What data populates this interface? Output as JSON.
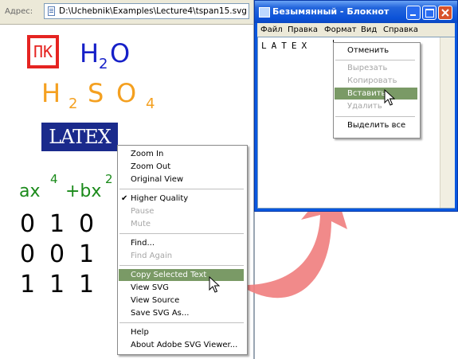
{
  "browser": {
    "address_label": "Адрес:",
    "address_value": "D:\\Uchebnik\\Examples\\Lecture4\\tspan15.svg"
  },
  "svg_content": {
    "pk_logo": "ПК",
    "h2o": {
      "base1": "H",
      "sub": "2",
      "base2": "O"
    },
    "h2so4": {
      "h": "H",
      "sub1": "2",
      "s": "S",
      "o": "O",
      "sub2": "4"
    },
    "latex_logo": "LATEX",
    "formula": {
      "a": "ax",
      "exp1": "4",
      "b": "+bx",
      "exp2": "2"
    },
    "matrix": [
      [
        "0",
        "1",
        "0"
      ],
      [
        "0",
        "0",
        "1"
      ],
      [
        "1",
        "1",
        "1"
      ]
    ]
  },
  "context_menu": {
    "items": [
      {
        "label": "Zoom In",
        "enabled": true
      },
      {
        "label": "Zoom Out",
        "enabled": true
      },
      {
        "label": "Original View",
        "enabled": true
      },
      {
        "label": "Higher Quality",
        "enabled": true,
        "checked": true
      },
      {
        "label": "Pause",
        "enabled": false
      },
      {
        "label": "Mute",
        "enabled": false
      },
      {
        "label": "Find...",
        "enabled": true
      },
      {
        "label": "Find Again",
        "enabled": false
      },
      {
        "label": "Copy Selected Text",
        "enabled": true,
        "highlighted": true
      },
      {
        "label": "View SVG",
        "enabled": true
      },
      {
        "label": "View Source",
        "enabled": true
      },
      {
        "label": "Save SVG As...",
        "enabled": true
      },
      {
        "label": "Help",
        "enabled": true
      },
      {
        "label": "About Adobe SVG Viewer...",
        "enabled": true
      }
    ],
    "check_glyph": "✔"
  },
  "notepad": {
    "title": "Безымянный - Блокнот",
    "menu": [
      "Файл",
      "Правка",
      "Формат",
      "Вид",
      "Справка"
    ],
    "text": "LATEX",
    "context_menu": {
      "items": [
        {
          "label": "Отменить",
          "enabled": true
        },
        {
          "label": "Вырезать",
          "enabled": false
        },
        {
          "label": "Копировать",
          "enabled": false
        },
        {
          "label": "Вставить",
          "enabled": true,
          "highlighted": true
        },
        {
          "label": "Удалить",
          "enabled": false
        },
        {
          "label": "Выделить все",
          "enabled": true
        }
      ]
    }
  },
  "colors": {
    "highlight": "#7a9a66",
    "arrow": "#f08080",
    "h2o": "#1620c8",
    "h2so4": "#f4a020",
    "formula": "#1a8a1a",
    "pk": "#e52421"
  }
}
